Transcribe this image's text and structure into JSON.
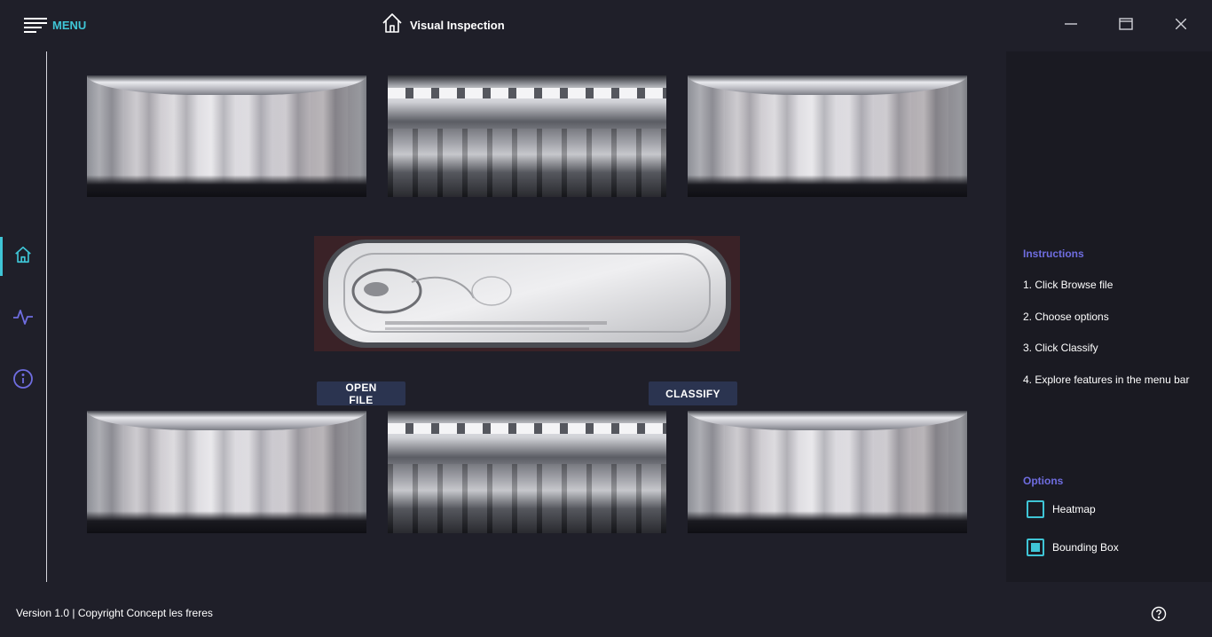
{
  "header": {
    "menu_label": "MENU",
    "title": "Visual Inspection"
  },
  "sidebar": {
    "items": [
      {
        "name": "home",
        "icon": "home-icon",
        "active": true
      },
      {
        "name": "activity",
        "icon": "activity-icon",
        "active": false
      },
      {
        "name": "info",
        "icon": "info-icon",
        "active": false
      }
    ]
  },
  "main": {
    "top_images": [
      "can-side-left",
      "can-end-top",
      "can-side-right"
    ],
    "center_image": "can-lid-top",
    "bottom_images": [
      "can-side-left",
      "can-end-bottom",
      "can-side-right"
    ],
    "open_file_label": "OPEN FILE",
    "classify_label": "CLASSIFY"
  },
  "instructions": {
    "title": "Instructions",
    "steps": [
      "1. Click Browse file",
      "2. Choose options",
      "3. Click Classify",
      "4. Explore features in the menu bar"
    ]
  },
  "options": {
    "title": "Options",
    "items": [
      {
        "label": "Heatmap",
        "checked": false
      },
      {
        "label": "Bounding Box",
        "checked": true
      }
    ]
  },
  "footer": {
    "version_text": "Version 1.0 | Copyright Concept les freres"
  },
  "colors": {
    "accent": "#3fc5d6",
    "section_title": "#6f6de0",
    "button_bg": "#2b3450",
    "background": "#1f1f29"
  }
}
